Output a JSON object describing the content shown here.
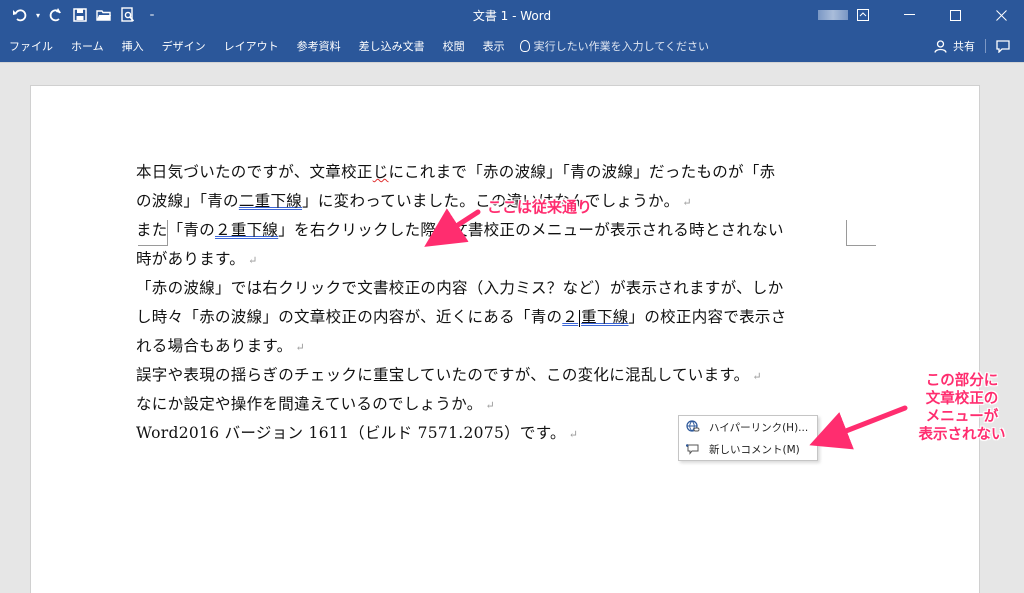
{
  "window": {
    "title": "文書 1  -  Word"
  },
  "qat": {
    "undo_icon": "undo-icon",
    "redo_icon": "redo-icon",
    "save_icon": "save-icon",
    "open_icon": "open-folder-icon",
    "preview_icon": "print-preview-icon",
    "customize_icon": "customize-qat-icon"
  },
  "ribbon": {
    "tabs": [
      "ファイル",
      "ホーム",
      "挿入",
      "デザイン",
      "レイアウト",
      "参考資料",
      "差し込み文書",
      "校閲",
      "表示"
    ],
    "tellme_placeholder": "実行したい作業を入力してください",
    "share_label": "共有"
  },
  "document": {
    "lines": [
      {
        "parts": [
          "本日気づいたのですが、文章校正",
          "じ",
          "にこれまで「赤の波線」「青の波線」だったものが「赤"
        ]
      },
      {
        "parts": [
          "の波線」「青の",
          "二重下線",
          "」に変わっていました。この違いはなんでしょうか。"
        ]
      },
      {
        "parts": [
          "また「青の",
          "２重下線",
          "」を右クリックした際、文書校正のメニューが表示される時とされない"
        ]
      },
      {
        "parts": [
          "時があります。"
        ]
      },
      {
        "parts": [
          "「赤の波線」では右クリックで文書校正の内容（入力ミス？など）が表示されますが、しか"
        ]
      },
      {
        "parts": [
          "し時々「赤の波線」の文章校正の内容が、近くにある「青の",
          "２",
          "重下線",
          "」の校正内容で表示さ"
        ]
      },
      {
        "parts": [
          "れる場合もあります。"
        ]
      },
      {
        "parts": [
          "誤字や表現の揺らぎのチェックに重宝していたのですが、この変化に",
          "混乱しています。"
        ]
      },
      {
        "parts": [
          "なにか設定や操作を間違えているのでしょうか。"
        ]
      },
      {
        "parts": [
          "Word2016  バージョン 1611（ビルド 7571.2075）です。"
        ]
      }
    ]
  },
  "context_menu": {
    "items": [
      {
        "label": "ハイパーリンク(H)...",
        "icon": "hyperlink-globe-icon"
      },
      {
        "label": "新しいコメント(M)",
        "icon": "new-comment-icon"
      }
    ]
  },
  "annotations": {
    "top": "ここは従来通り",
    "right_lines": [
      "この部分に",
      "文章校正の",
      "メニューが",
      "表示されない"
    ],
    "color": "#ff2d6f"
  },
  "colors": {
    "titlebar": "#2b579a",
    "spell_underline": "#e03030",
    "grammar_underline": "#3c66d6"
  }
}
